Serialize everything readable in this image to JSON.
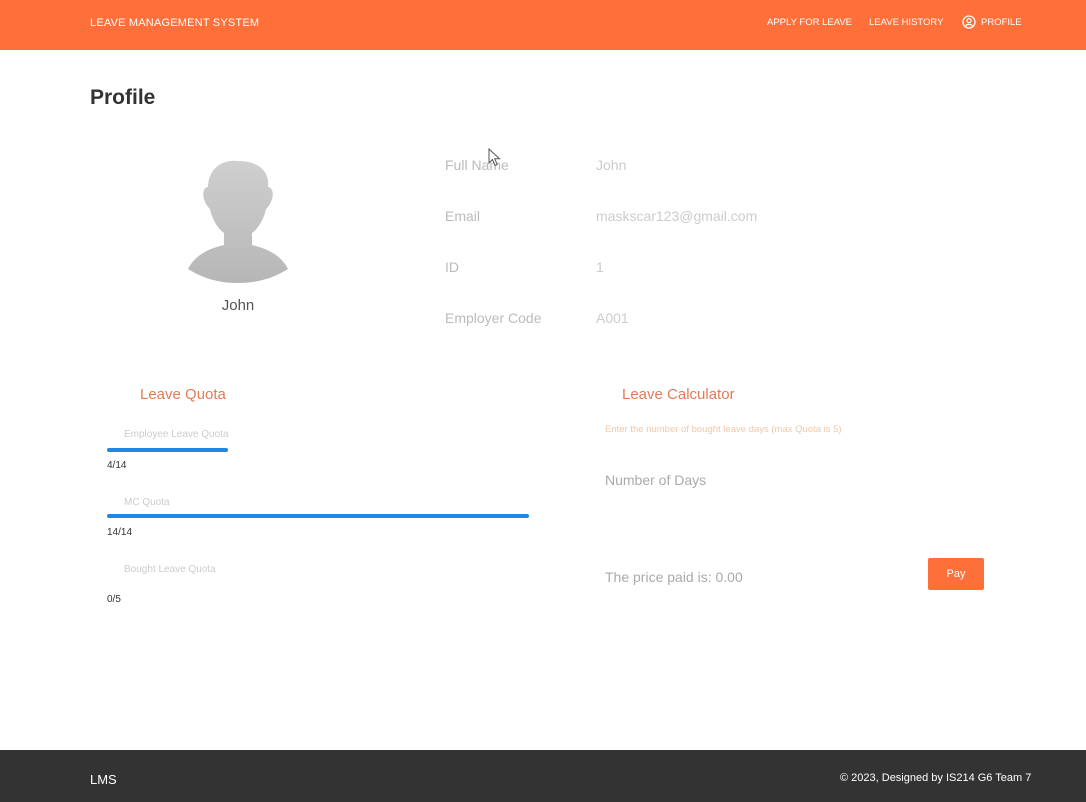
{
  "nav": {
    "brand": "LEAVE MANAGEMENT SYSTEM",
    "apply_label": "APPLY FOR LEAVE",
    "history_label": "LEAVE HISTORY",
    "profile_label": "PROFILE",
    "accent_color": "#ff6f3a"
  },
  "page": {
    "title": "Profile"
  },
  "profile": {
    "name": "John",
    "fields": [
      {
        "label": "Full Name",
        "value": "John"
      },
      {
        "label": "Email",
        "value": "maskscar123@gmail.com"
      },
      {
        "label": "ID",
        "value": "1"
      },
      {
        "label": "Employer Code",
        "value": "A001"
      }
    ]
  },
  "quota": {
    "title": "Leave Quota",
    "items": [
      {
        "label": "Employee Leave Quota",
        "value": "4/14",
        "fraction": 0.286
      },
      {
        "label": "MC Quota",
        "value": "14/14",
        "fraction": 1.0
      },
      {
        "label": "Bought Leave Quota",
        "value": "0/5",
        "fraction": 0.0
      }
    ],
    "bar_color": "#1e88e5"
  },
  "calculator": {
    "title": "Leave Calculator",
    "hint": "Enter the number of bought leave days (max Quota is 5)",
    "input_placeholder": "Number of Days",
    "price_text": "The price paid is: 0.00",
    "pay_label": "Pay"
  },
  "footer": {
    "brand": "LMS",
    "copyright": "© 2023, Designed by IS214 G6 Team 7"
  }
}
